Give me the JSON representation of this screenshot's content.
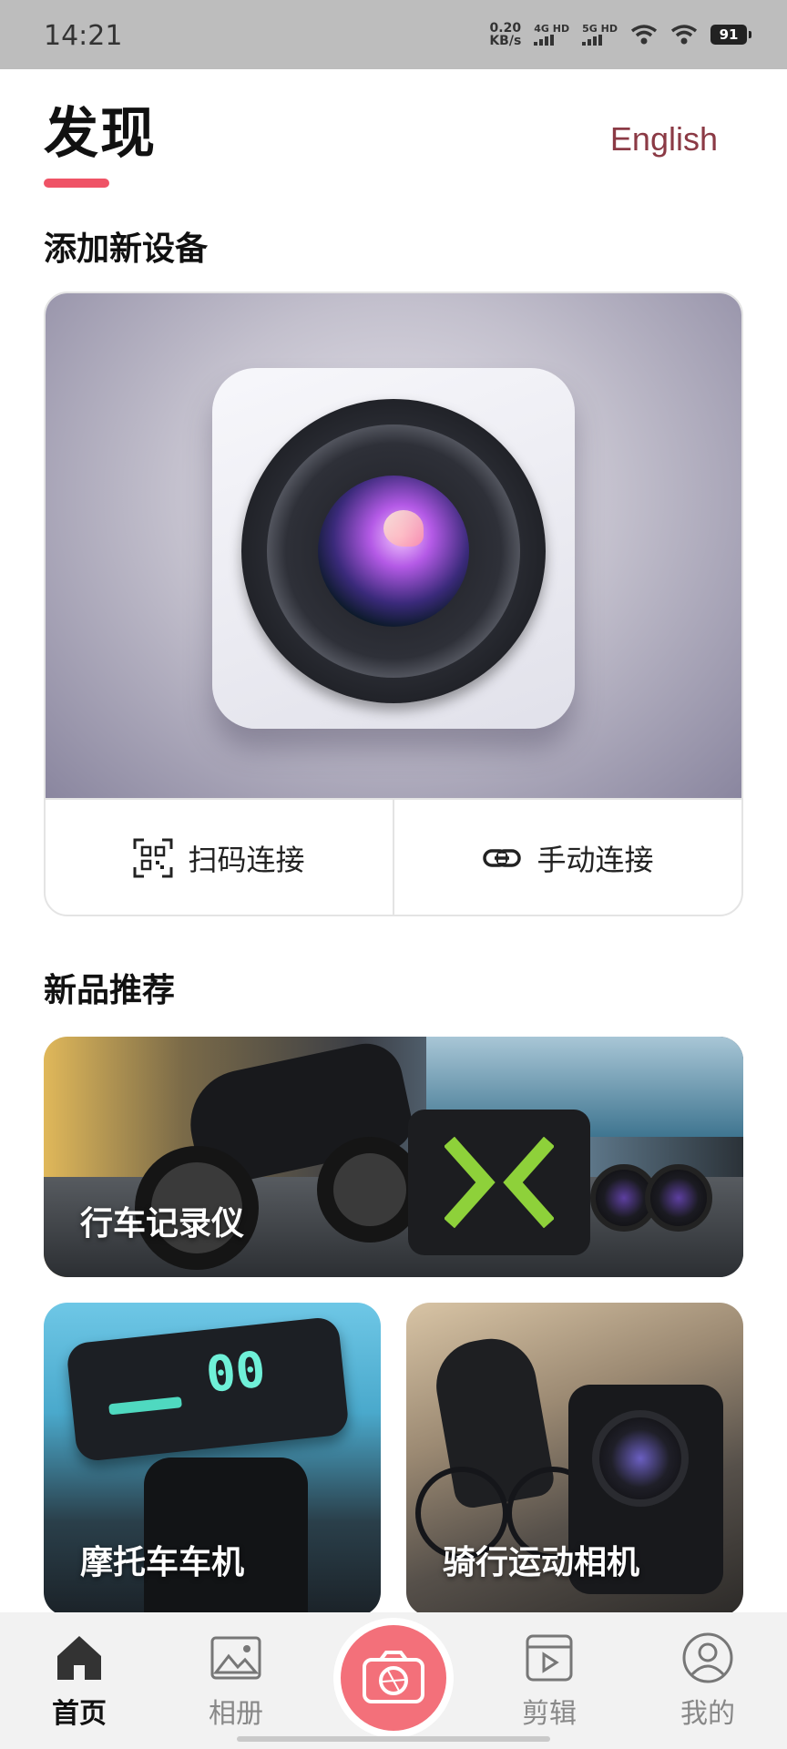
{
  "status_bar": {
    "time": "14:21",
    "net_speed_value": "0.20",
    "net_speed_unit": "KB/s",
    "signal1_label": "4G HD",
    "signal2_label": "5G HD",
    "battery": "91"
  },
  "header": {
    "title": "发现",
    "language_link": "English",
    "accent_color": "#ef5366"
  },
  "add_device": {
    "section_title": "添加新设备",
    "scan_label": "扫码连接",
    "manual_label": "手动连接"
  },
  "new_products": {
    "section_title": "新品推荐",
    "items": [
      {
        "label": "行车记录仪"
      },
      {
        "label": "摩托车车机"
      },
      {
        "label": "骑行运动相机"
      }
    ]
  },
  "bottom_nav": {
    "items": [
      {
        "label": "首页",
        "icon": "home-icon",
        "active": true
      },
      {
        "label": "相册",
        "icon": "gallery-icon",
        "active": false
      },
      {
        "label": "",
        "icon": "camera-icon",
        "active": false
      },
      {
        "label": "剪辑",
        "icon": "video-edit-icon",
        "active": false
      },
      {
        "label": "我的",
        "icon": "profile-icon",
        "active": false
      }
    ],
    "camera_color": "#f3707a"
  }
}
